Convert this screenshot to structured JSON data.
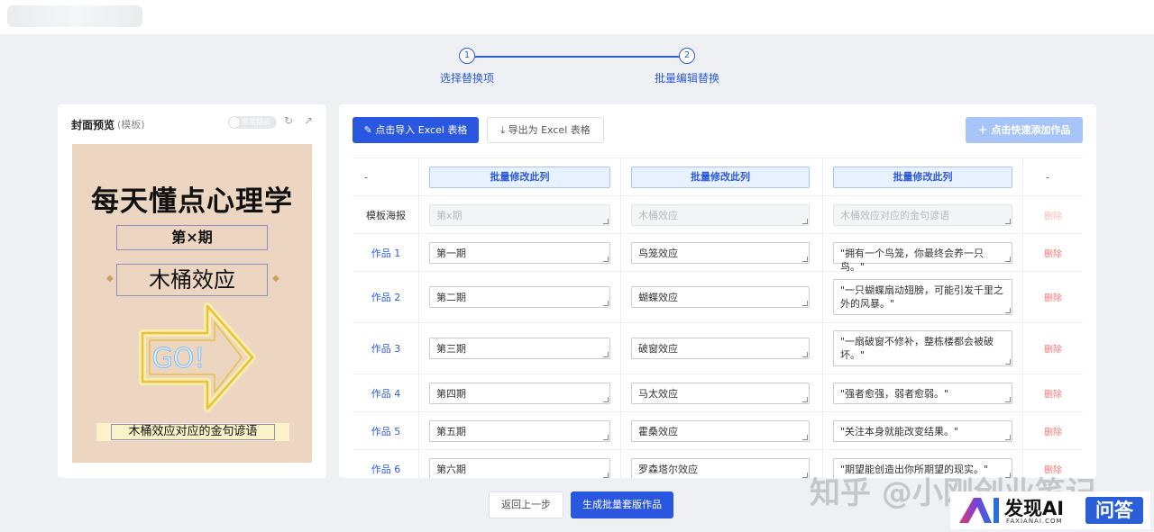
{
  "steps": [
    {
      "number": "1",
      "label": "选择替换项"
    },
    {
      "number": "2",
      "label": "批量编辑替换"
    }
  ],
  "preview": {
    "title": "封面预览",
    "subtitle": "(模板)",
    "toggle_label": "非常提示",
    "poster": {
      "title": "每天懂点心理学",
      "issue": "第×期",
      "effect": "木桶效应",
      "arrow_text": "GO!",
      "quote": "木桶效应对应的金句谚语",
      "background_color": "#ecd6c2"
    }
  },
  "toolbar": {
    "import_label": "点击导入 Excel 表格",
    "export_label": "导出为 Excel 表格",
    "add_label": "点击快速添加作品",
    "accent_color": "#2a57e0"
  },
  "table": {
    "header": {
      "col0": "-",
      "batch_label": "批量修改此列",
      "col4": "-"
    },
    "template_row": {
      "label": "模板海报",
      "values": [
        "第x期",
        "木桶效应",
        "木桶效应对应的金句谚语"
      ],
      "delete_label": "删除"
    },
    "rows": [
      {
        "label": "作品 1",
        "values": [
          "第一期",
          "鸟笼效应",
          "\"拥有一个鸟笼，你最终会养一只鸟。\""
        ],
        "delete_label": "删除"
      },
      {
        "label": "作品 2",
        "values": [
          "第二期",
          "蝴蝶效应",
          "\"一只蝴蝶扇动翅膀，可能引发千里之外的风暴。\""
        ],
        "delete_label": "删除"
      },
      {
        "label": "作品 3",
        "values": [
          "第三期",
          "破窗效应",
          "\"一扇破窗不修补，整栋楼都会被破坏。\""
        ],
        "delete_label": "删除"
      },
      {
        "label": "作品 4",
        "values": [
          "第四期",
          "马太效应",
          "\"强者愈强，弱者愈弱。\""
        ],
        "delete_label": "删除"
      },
      {
        "label": "作品 5",
        "values": [
          "第五期",
          "霍桑效应",
          "\"关注本身就能改变结果。\""
        ],
        "delete_label": "删除"
      },
      {
        "label": "作品 6",
        "values": [
          "第六期",
          "罗森塔尔效应",
          "\"期望能创造出你所期望的现实。\""
        ],
        "delete_label": "删除"
      }
    ]
  },
  "footer": {
    "back_label": "返回上一步",
    "generate_label": "生成批量套版作品"
  },
  "watermark": {
    "zhihu_text": "知乎 @小刚创业笔记",
    "brand": "发现AI",
    "url": "FAXIANAI.COM",
    "qa": "问答"
  }
}
